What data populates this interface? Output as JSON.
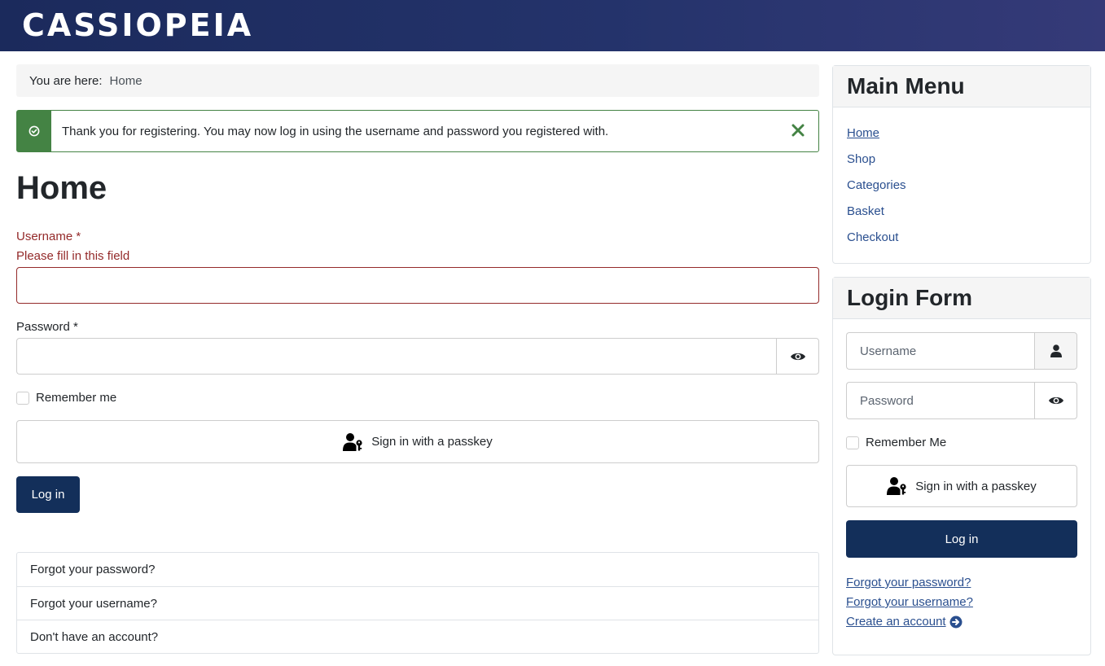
{
  "header": {
    "brand": "CASSIOPEIA"
  },
  "breadcrumb": {
    "label": "You are here:",
    "current": "Home"
  },
  "alert": {
    "message": "Thank you for registering. You may now log in using the username and password you registered with.",
    "icon": "check-circle-icon",
    "close_icon": "close-icon"
  },
  "page": {
    "title": "Home"
  },
  "login": {
    "username_label": "Username *",
    "username_error": "Please fill in this field",
    "username_value": "",
    "password_label": "Password *",
    "password_value": "",
    "remember_label": "Remember me",
    "passkey_label": "Sign in with a passkey",
    "login_label": "Log in",
    "links": [
      "Forgot your password?",
      "Forgot your username?",
      "Don't have an account?"
    ]
  },
  "main_menu": {
    "title": "Main Menu",
    "items": [
      "Home",
      "Shop",
      "Categories",
      "Basket",
      "Checkout"
    ],
    "active": "Home"
  },
  "login_module": {
    "title": "Login Form",
    "username_placeholder": "Username",
    "password_placeholder": "Password",
    "remember_label": "Remember Me",
    "passkey_label": "Sign in with a passkey",
    "login_label": "Log in",
    "links": [
      "Forgot your password?",
      "Forgot your username?",
      "Create an account"
    ]
  },
  "colors": {
    "header_start": "#1b2a5c",
    "header_end": "#353a78",
    "success": "#448344",
    "error": "#942a2a",
    "primary_button": "#132f5a",
    "link": "#2a4f8f"
  }
}
